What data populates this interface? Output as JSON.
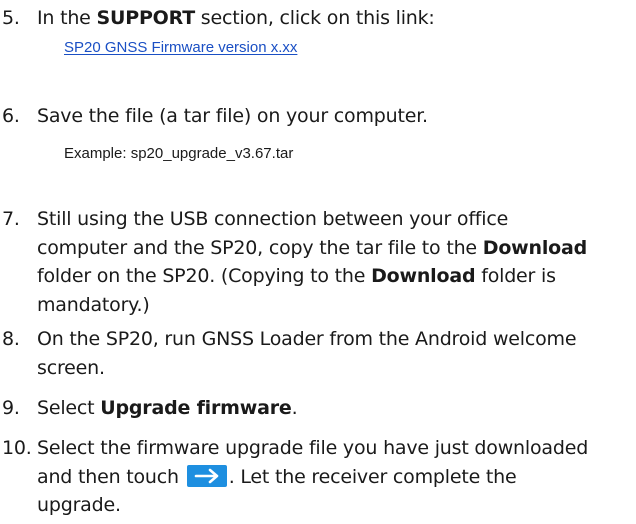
{
  "steps": [
    {
      "number": "5.",
      "text_before": "In the ",
      "bold1": "SUPPORT",
      "text_after": " section, click on this link:",
      "link": "SP20 GNSS Firmware version x.xx"
    },
    {
      "number": "6.",
      "text": "Save the file (a tar file) on your computer.",
      "example": "Example: sp20_upgrade_v3.67.tar"
    },
    {
      "number": "7.",
      "line1": "Still using the USB connection between your office",
      "line2_before": "computer and the SP20, copy the tar file to the ",
      "line2_bold": "Download",
      "line3_before": "folder on the SP20. (Copying to the ",
      "line3_bold": "Download",
      "line3_after": " folder is",
      "line4": "mandatory.)"
    },
    {
      "number": "8.",
      "line1": "On the SP20, run GNSS Loader from the Android welcome",
      "line2": "screen."
    },
    {
      "number": "9.",
      "text_before": "Select ",
      "bold": "Upgrade firmware",
      "text_after": "."
    },
    {
      "number": "10.",
      "line1": "Select the firmware upgrade file you have just downloaded",
      "line2_before": "and then touch ",
      "line2_after": ". Let the receiver complete the",
      "line3": "upgrade."
    }
  ],
  "colors": {
    "link": "#1a4fc4",
    "arrow_button_bg": "#1e8fe0",
    "arrow_icon": "#ffffff",
    "text": "#1a1a1a"
  },
  "icons": {
    "next_button": "arrow-right-icon"
  }
}
